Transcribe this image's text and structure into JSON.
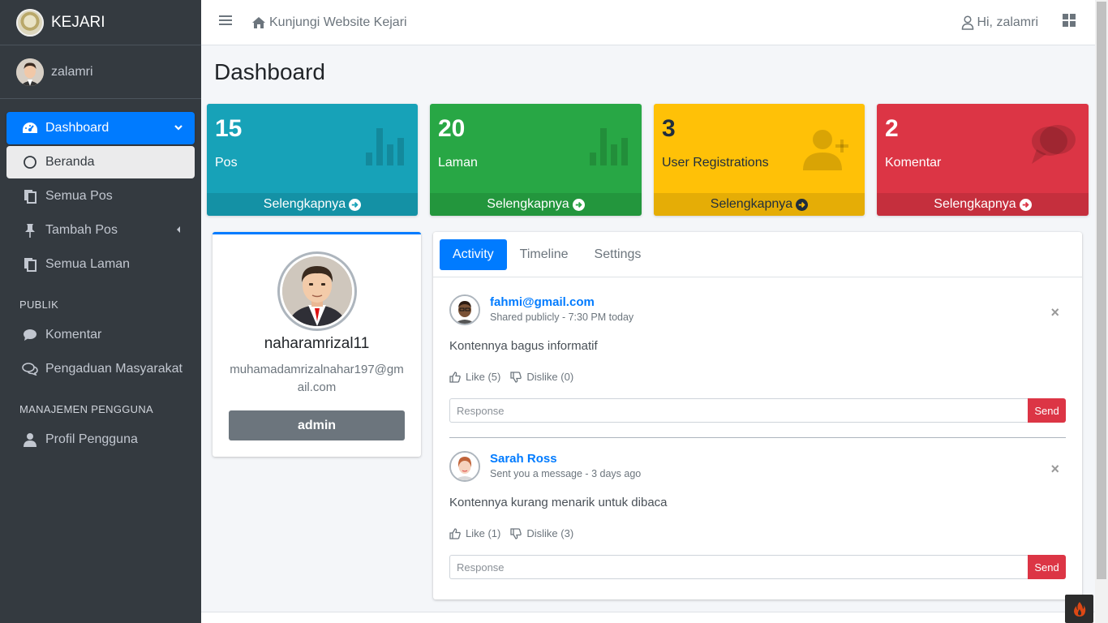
{
  "brand": {
    "name": "KEJARI"
  },
  "user": {
    "name": "zalamri"
  },
  "sidebar": {
    "items": [
      {
        "label": "Dashboard",
        "icon": "tachometer-icon"
      },
      {
        "label": "Beranda",
        "icon": "circle-icon"
      },
      {
        "label": "Semua Pos",
        "icon": "copy-icon"
      },
      {
        "label": "Tambah Pos",
        "icon": "thumbtack-icon"
      },
      {
        "label": "Semua Laman",
        "icon": "copy-icon"
      }
    ],
    "header_public": "PUBLIK",
    "public_items": [
      {
        "label": "Komentar",
        "icon": "comment-icon"
      },
      {
        "label": "Pengaduan Masyarakat",
        "icon": "comments-icon"
      }
    ],
    "header_users": "MANAJEMEN PENGGUNA",
    "user_items": [
      {
        "label": "Profil Pengguna",
        "icon": "user-icon"
      }
    ]
  },
  "topbar": {
    "link": "Kunjungi Website Kejari",
    "greeting": "Hi, zalamri"
  },
  "page": {
    "title": "Dashboard"
  },
  "stats": [
    {
      "value": "15",
      "label": "Pos",
      "link": "Selengkapnya",
      "color": "#17a2b8"
    },
    {
      "value": "20",
      "label": "Laman",
      "link": "Selengkapnya",
      "color": "#28a745"
    },
    {
      "value": "3",
      "label": "User Registrations",
      "link": "Selengkapnya",
      "color": "#ffc107"
    },
    {
      "value": "2",
      "label": "Komentar",
      "link": "Selengkapnya",
      "color": "#dc3545"
    }
  ],
  "profile": {
    "username": "naharamrizal11",
    "email": "muhamadamrizalnahar197@gmail.com",
    "role": "admin"
  },
  "tabs": [
    "Activity",
    "Timeline",
    "Settings"
  ],
  "posts": [
    {
      "user": "fahmi@gmail.com",
      "desc": "Shared publicly - 7:30 PM today",
      "text": "Kontennya bagus informatif",
      "like": "Like (5)",
      "dislike": "Dislike (0)",
      "placeholder": "Response",
      "send": "Send"
    },
    {
      "user": "Sarah Ross",
      "desc": "Sent you a message - 3 days ago",
      "text": "Kontennya kurang menarik untuk dibaca",
      "like": "Like (1)",
      "dislike": "Dislike (3)",
      "placeholder": "Response",
      "send": "Send"
    }
  ]
}
